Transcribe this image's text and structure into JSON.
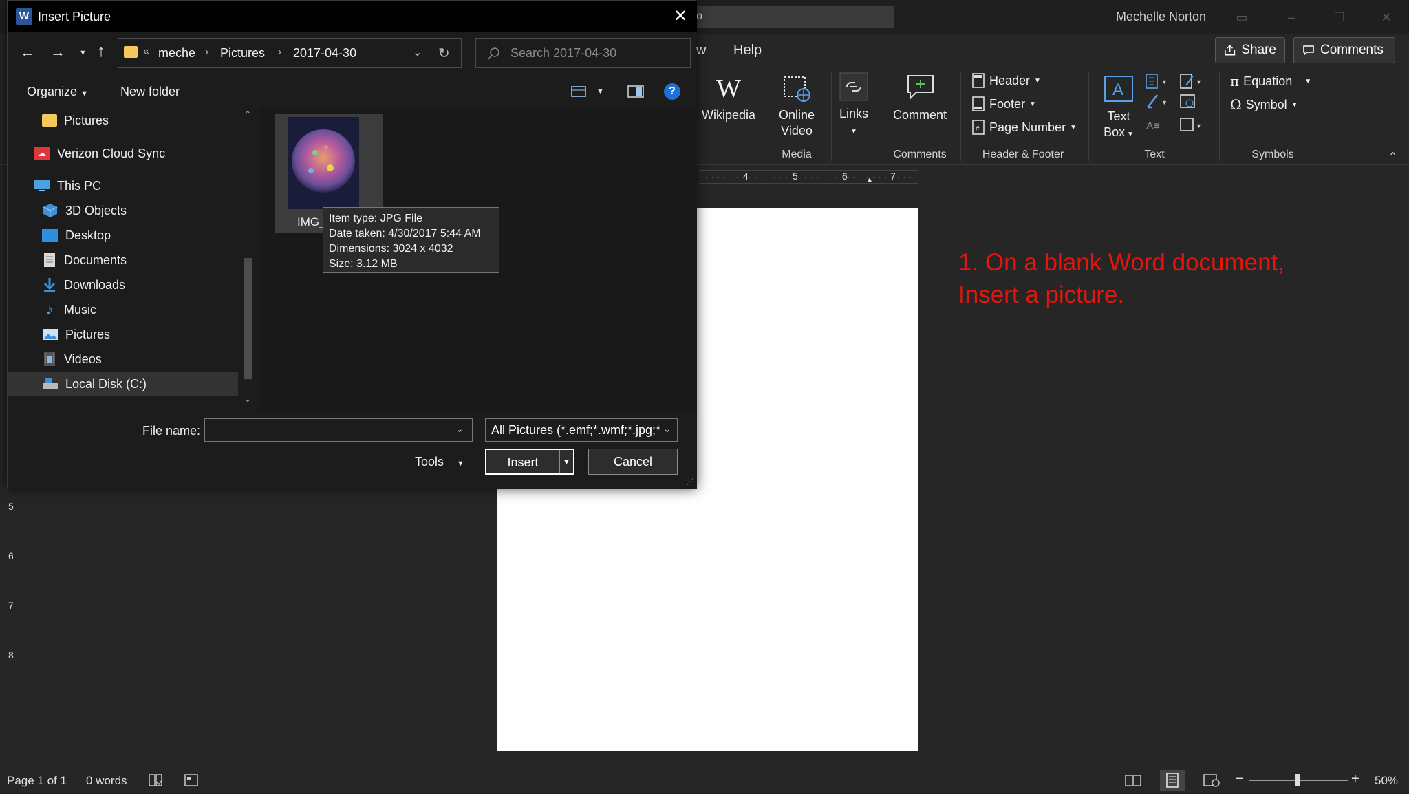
{
  "word": {
    "search_fragment": "o",
    "user_name": "Mechelle Norton",
    "tabs": {
      "partial": "w",
      "help": "Help"
    },
    "share_label": "Share",
    "comments_label": "Comments",
    "ribbon": {
      "wikipedia": "Wikipedia",
      "online_video_line1": "Online",
      "online_video_line2": "Video",
      "links": "Links",
      "comment": "Comment",
      "header": "Header",
      "footer": "Footer",
      "page_number": "Page Number",
      "text_box_line1": "Text",
      "text_box_line2": "Box",
      "equation": "Equation",
      "symbol": "Symbol",
      "groups": {
        "media": "Media",
        "comments": "Comments",
        "header_footer": "Header & Footer",
        "text": "Text",
        "symbols": "Symbols"
      }
    },
    "ruler_numbers": [
      "4",
      "5",
      "6",
      "7"
    ],
    "vruler_numbers": [
      "5",
      "6",
      "7",
      "8"
    ],
    "annotation_line1": "1. On a blank Word document,",
    "annotation_line2": "Insert a picture.",
    "status": {
      "page": "Page 1 of 1",
      "words": "0 words",
      "zoom": "50%"
    },
    "zoom_level": 0.5
  },
  "dialog": {
    "title": "Insert Picture",
    "breadcrumb": [
      "meche",
      "Pictures",
      "2017-04-30"
    ],
    "search_placeholder": "Search 2017-04-30",
    "organize": "Organize",
    "new_folder": "New folder",
    "nav_items": [
      {
        "label": "Pictures",
        "icon": "folder-icon"
      },
      {
        "label": "Verizon Cloud Sync",
        "icon": "cloud-sync-icon"
      },
      {
        "label": "This PC",
        "icon": "computer-icon"
      },
      {
        "label": "3D Objects",
        "icon": "3d-objects-icon"
      },
      {
        "label": "Desktop",
        "icon": "desktop-icon"
      },
      {
        "label": "Documents",
        "icon": "documents-icon"
      },
      {
        "label": "Downloads",
        "icon": "downloads-icon"
      },
      {
        "label": "Music",
        "icon": "music-icon"
      },
      {
        "label": "Pictures",
        "icon": "pictures-icon"
      },
      {
        "label": "Videos",
        "icon": "videos-icon"
      },
      {
        "label": "Local Disk (C:)",
        "icon": "local-disk-icon"
      }
    ],
    "file": {
      "name": "IMG_2"
    },
    "tooltip": {
      "line1": "Item type: JPG File",
      "line2": "Date taken: 4/30/2017 5:44 AM",
      "line3": "Dimensions: 3024 x 4032",
      "line4": "Size: 3.12 MB"
    },
    "file_name_label": "File name:",
    "file_name_value": "",
    "filter": "All Pictures (*.emf;*.wmf;*.jpg;*",
    "tools": "Tools",
    "insert": "Insert",
    "cancel": "Cancel"
  },
  "colors": {
    "annotation": "#e8150d",
    "help_icon": "#1e6fd9",
    "folder": "#f4c85a"
  }
}
